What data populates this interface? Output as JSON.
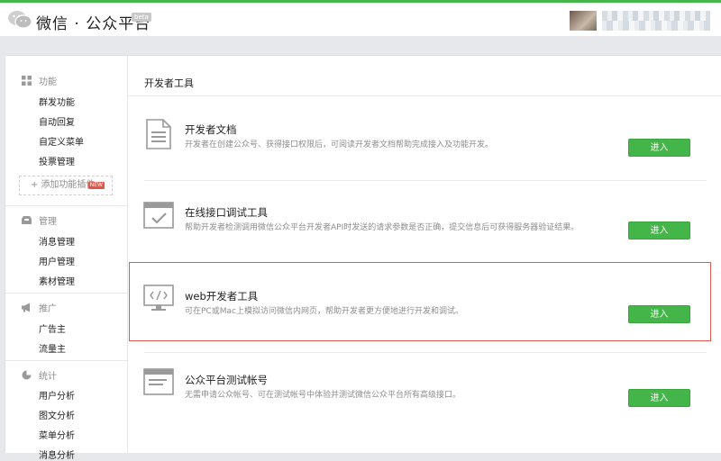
{
  "header": {
    "brand": "微信 · 公众平台",
    "beta": "beta"
  },
  "sidebar": {
    "sections": [
      {
        "title": "功能",
        "icon": "grid-icon",
        "items": [
          "群发功能",
          "自动回复",
          "自定义菜单",
          "投票管理"
        ]
      },
      {
        "title": "管理",
        "icon": "inbox-icon",
        "items": [
          "消息管理",
          "用户管理",
          "素材管理"
        ]
      },
      {
        "title": "推广",
        "icon": "megaphone-icon",
        "items": [
          "广告主",
          "流量主"
        ]
      },
      {
        "title": "统计",
        "icon": "pie-icon",
        "items": [
          "用户分析",
          "图文分析",
          "菜单分析",
          "消息分析"
        ]
      }
    ],
    "add_plugin": "添加功能插件",
    "new_tag": "NEW"
  },
  "main": {
    "title": "开发者工具",
    "tools": [
      {
        "title": "开发者文档",
        "desc": "开发者在创建公众号、获得接口权限后，可阅读开发者文档帮助完成接入及功能开发。",
        "button": "进入",
        "icon": "document-icon"
      },
      {
        "title": "在线接口调试工具",
        "desc": "帮助开发者检测调用微信公众平台开发者API时发送的请求参数是否正确，提交信息后可获得服务器验证结果。",
        "button": "进入",
        "icon": "browser-check-icon"
      },
      {
        "title": "web开发者工具",
        "desc": "可在PC或Mac上模拟访问微信内网页，帮助开发者更方便地进行开发和调试。",
        "button": "进入",
        "icon": "monitor-code-icon"
      },
      {
        "title": "公众平台测试帐号",
        "desc": "无需申请公众帐号、可在测试帐号中体验并测试微信公众平台所有高级接口。",
        "button": "进入",
        "icon": "browser-window-icon"
      }
    ]
  },
  "colors": {
    "accent": "#44b549",
    "highlight": "#e05a52"
  }
}
